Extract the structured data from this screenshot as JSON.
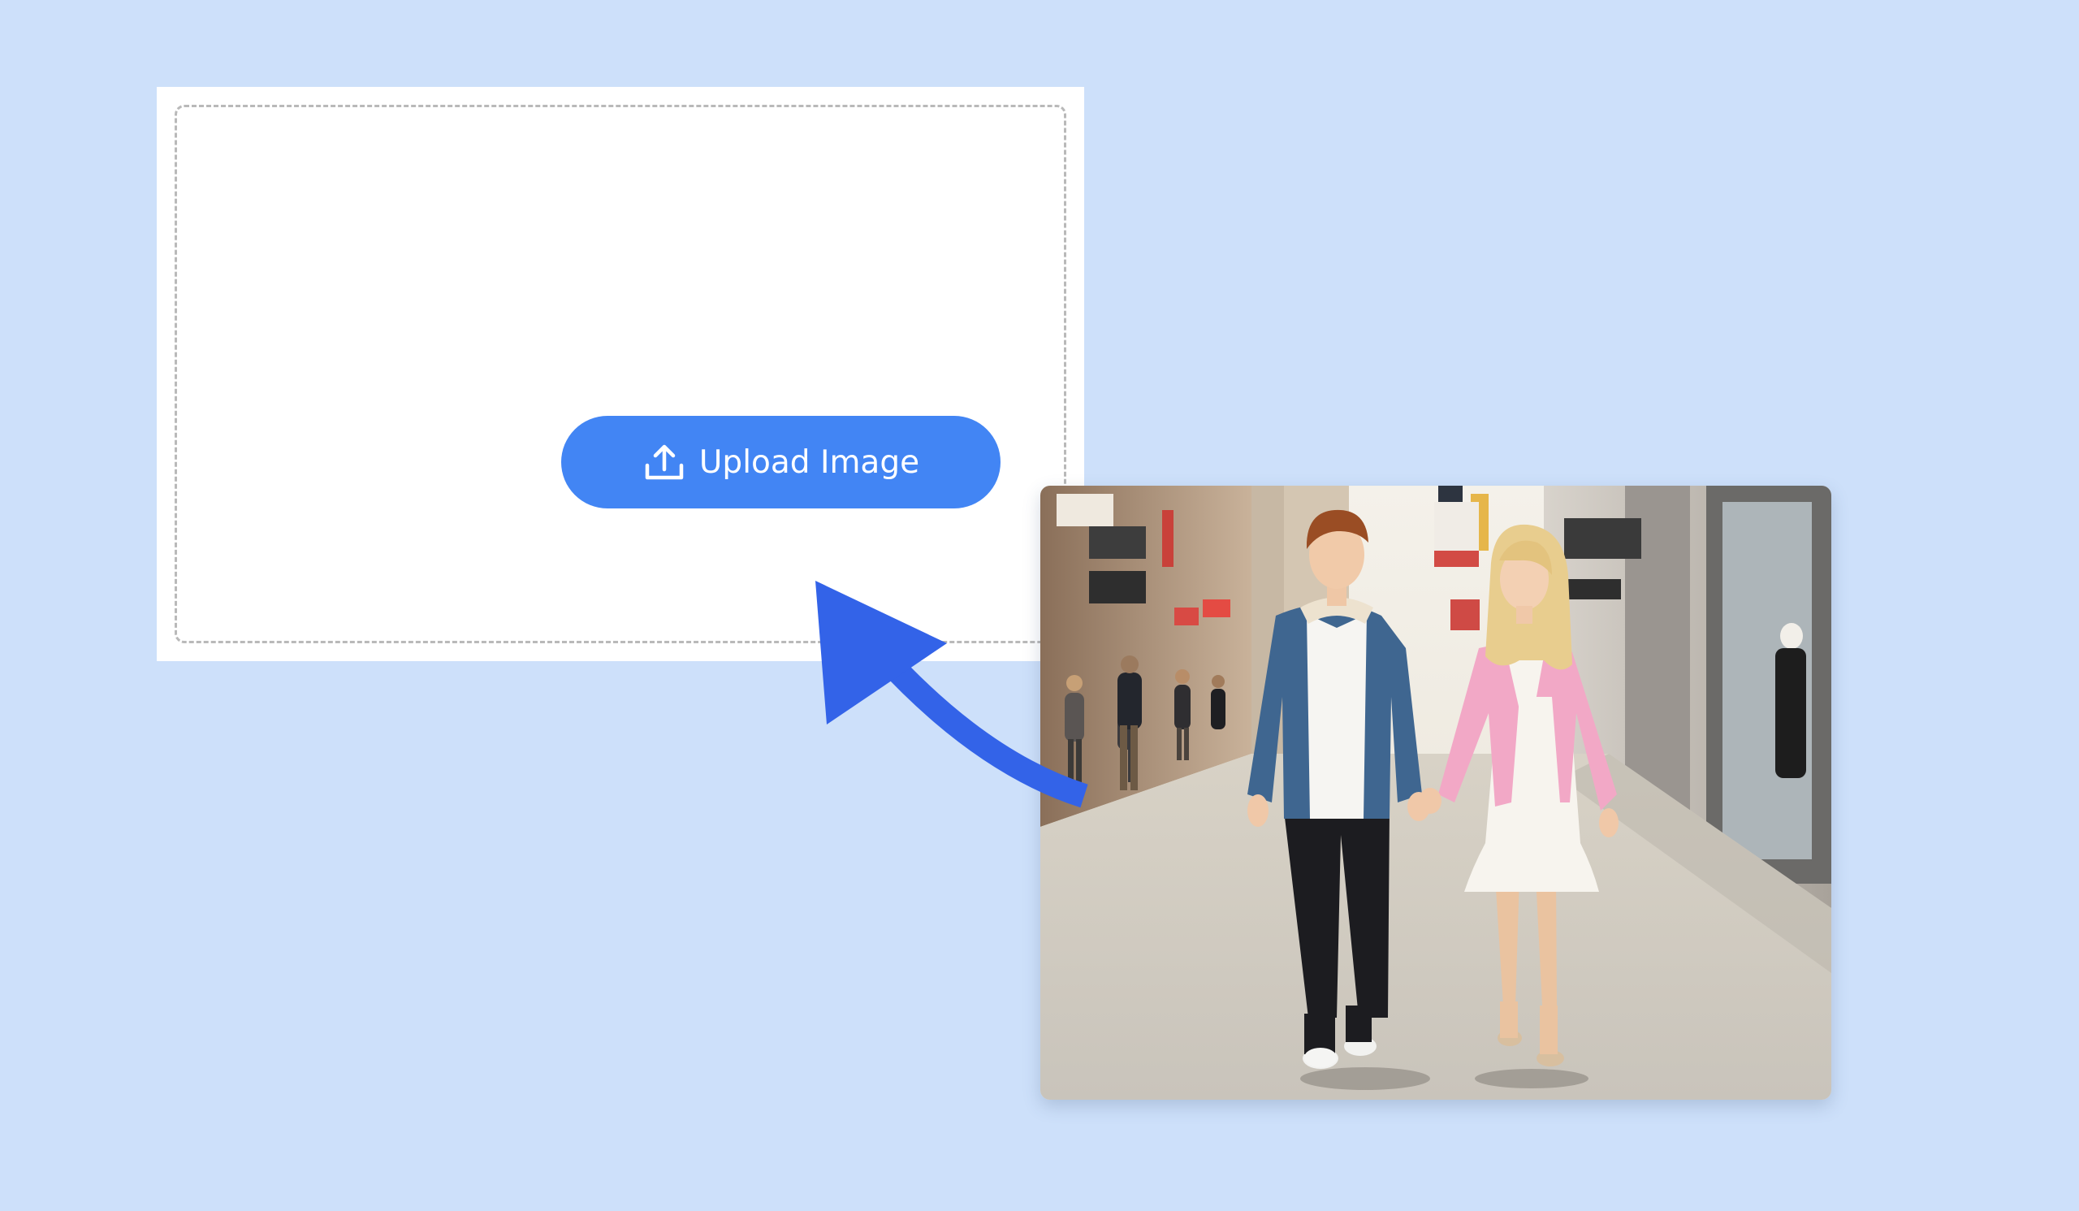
{
  "upload": {
    "button_label": "Upload Image",
    "icon": "upload-icon"
  },
  "photo": {
    "subject": "couple-walking-photo"
  },
  "colors": {
    "background": "#cde0fa",
    "button": "#4285f4",
    "arrow": "#3363e8",
    "dropzone_border": "#b9b9b9"
  }
}
